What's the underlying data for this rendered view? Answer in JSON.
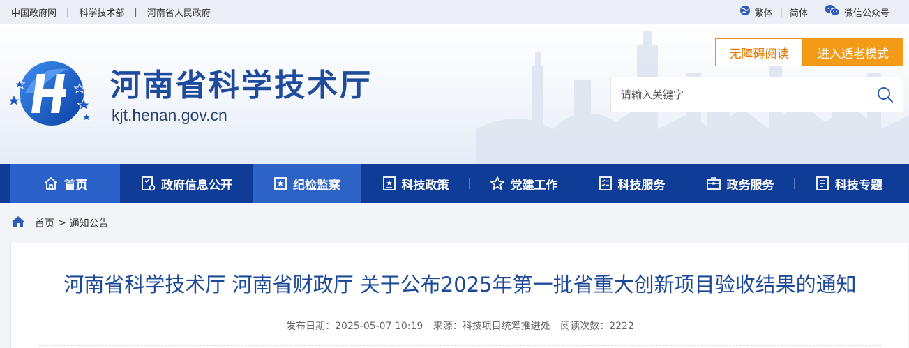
{
  "topbar": {
    "links": [
      "中国政府网",
      "科学技术部",
      "河南省人民政府"
    ],
    "separator": "|",
    "traditional": "繁体",
    "simplified": "简体",
    "divider": "|",
    "wechat": "微信公众号"
  },
  "header": {
    "site_title": "河南省科学技术厅",
    "site_domain": "kjt.henan.gov.cn",
    "accessible_label": "无障碍阅读",
    "elder_mode_label": "进入适老模式",
    "search_placeholder": "请输入关键字"
  },
  "nav": {
    "items": [
      {
        "label": "首页",
        "icon": "home-icon"
      },
      {
        "label": "政府信息公开",
        "icon": "info-icon"
      },
      {
        "label": "纪检监察",
        "icon": "supervision-icon"
      },
      {
        "label": "科技政策",
        "icon": "policy-icon"
      },
      {
        "label": "党建工作",
        "icon": "star-icon"
      },
      {
        "label": "科技服务",
        "icon": "checklist-icon"
      },
      {
        "label": "政务服务",
        "icon": "briefcase-icon"
      },
      {
        "label": "科技专题",
        "icon": "document-icon"
      }
    ]
  },
  "breadcrumb": {
    "home": "首页",
    "separator": ">",
    "current": "通知公告"
  },
  "article": {
    "title": "河南省科学技术厅 河南省财政厅 关于公布2025年第一批省重大创新项目验收结果的通知",
    "publish_date": "发布日期：2025-05-07 10:19",
    "source": "来源：科技项目统筹推进处",
    "views": "阅读次数：2222"
  },
  "colors": {
    "brand_blue": "#0e3c97",
    "title_blue": "#1c4a96",
    "orange": "#f39a17"
  }
}
